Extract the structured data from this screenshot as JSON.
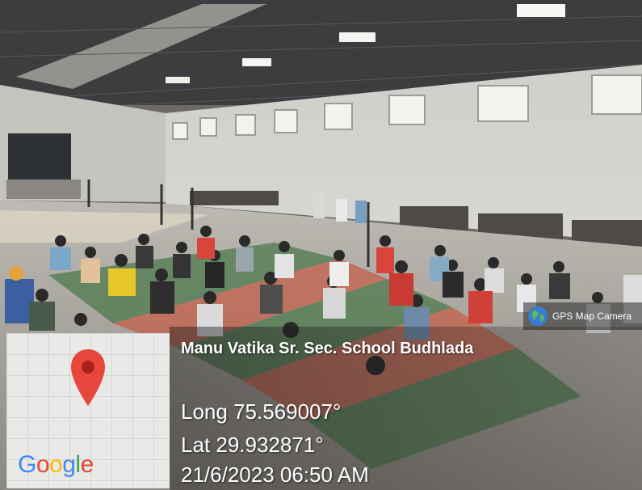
{
  "photo": {
    "description_icon": "photo-scene"
  },
  "gps_badge": {
    "label": "GPS Map Camera",
    "icon": "globe-icon"
  },
  "map": {
    "pin_icon": "map-pin-icon",
    "logo": "Google"
  },
  "location": {
    "place": "Manu Vatika Sr. Sec. School Budhlada",
    "longitude": "Long 75.569007°",
    "latitude": "Lat 29.932871°",
    "datetime": "21/6/2023 06:50 AM"
  },
  "colors": {
    "pin_red": "#e8453c",
    "google_blue": "#4285F4",
    "google_red": "#EA4335",
    "google_yellow": "#FBBC05",
    "google_green": "#34A853"
  }
}
